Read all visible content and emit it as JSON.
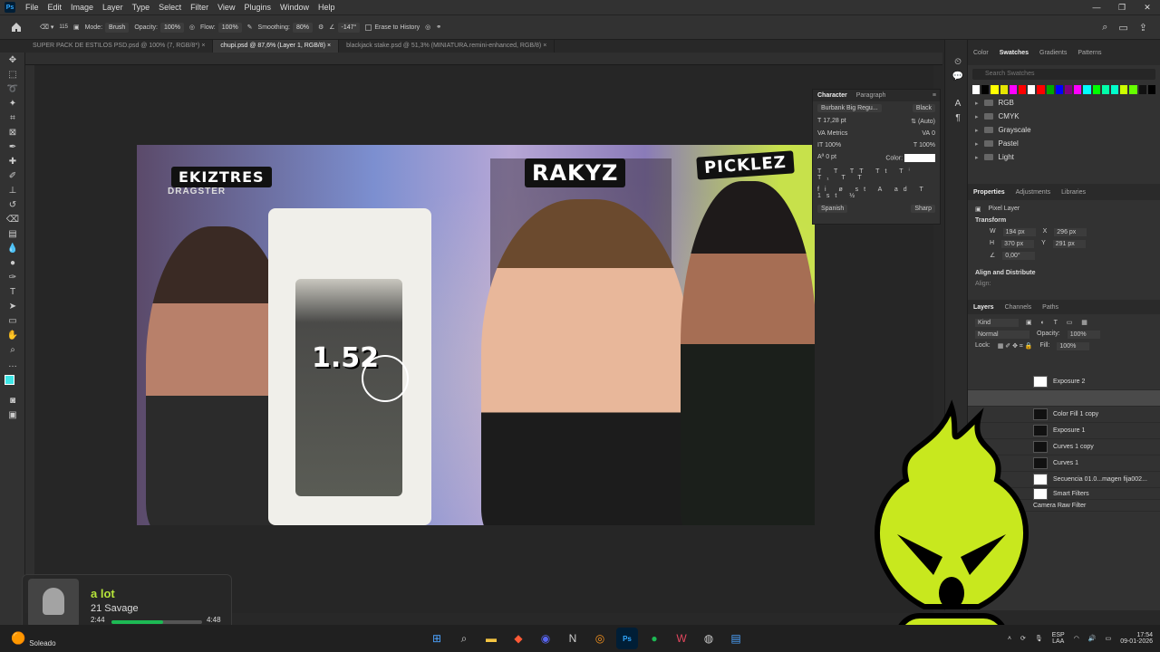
{
  "menubar": {
    "items": [
      "File",
      "Edit",
      "Image",
      "Layer",
      "Type",
      "Select",
      "Filter",
      "View",
      "Plugins",
      "Window",
      "Help"
    ],
    "app_icon": "Ps"
  },
  "options": {
    "mode_label": "Mode:",
    "mode_value": "Brush",
    "opacity_label": "Opacity:",
    "opacity_value": "100%",
    "flow_label": "Flow:",
    "flow_value": "100%",
    "smoothing_label": "Smoothing:",
    "smoothing_value": "80%",
    "angle_value": "-147°",
    "erase_history": "Erase to History",
    "brush_size": "115"
  },
  "tabs": [
    {
      "label": "SUPER PACK DE ESTILOS PSD.psd @ 100% (7, RGB/8*)"
    },
    {
      "label": "chupi.psd @ 87,6% (Layer 1, RGB/8)"
    },
    {
      "label": "blackjack stake.psd @ 51,3% (MINIATURA.remini-enhanced, RGB/8)"
    }
  ],
  "photo": {
    "names": [
      "EKIZTRES",
      "RAKYZ",
      "PICKLEZ"
    ],
    "number": "1.52",
    "dragster_text": "DRAGSTER"
  },
  "character": {
    "tab_character": "Character",
    "tab_paragraph": "Paragraph",
    "font": "Burbank Big Regu...",
    "style": "Black",
    "size": "17,28 pt",
    "leading": "(Auto)",
    "kerning": "Metrics",
    "tracking": "0",
    "vscale": "100%",
    "hscale": "100%",
    "baseline": "0 pt",
    "color_label": "Color:",
    "language": "Spanish",
    "antialias": "Sharp"
  },
  "swatches": {
    "tabs": [
      "Color",
      "Swatches",
      "Gradients",
      "Patterns"
    ],
    "search_placeholder": "Search Swatches",
    "colors": [
      "#ffffff",
      "#000000",
      "#ffff00",
      "#e6e600",
      "#ff00ff",
      "#ff0000",
      "#ffffff",
      "#ff0000",
      "#00aa00",
      "#0000ff",
      "#800080",
      "#ff00ff",
      "#00ffff",
      "#00ff00",
      "#00ffaa",
      "#00ffcc",
      "#ccff00",
      "#66ff00",
      "#111111",
      "#000000"
    ],
    "folders": [
      "RGB",
      "CMYK",
      "Grayscale",
      "Pastel",
      "Light"
    ]
  },
  "properties": {
    "tabs": [
      "Properties",
      "Adjustments",
      "Libraries"
    ],
    "kind": "Pixel Layer",
    "transform_label": "Transform",
    "w": "194 px",
    "h": "370 px",
    "x": "296 px",
    "y": "291 px",
    "angle": "0,00°",
    "align_label": "Align and Distribute",
    "align_sub": "Align:"
  },
  "layers": {
    "tabs": [
      "Layers",
      "Channels",
      "Paths"
    ],
    "filter_kind": "Kind",
    "blend": "Normal",
    "opacity_label": "Opacity:",
    "opacity": "100%",
    "lock_label": "Lock:",
    "fill_label": "Fill:",
    "fill": "100%",
    "items": [
      "Exposure 2",
      "",
      "Color Fill 1 copy",
      "Exposure 1",
      "Curves 1 copy",
      "Curves 1",
      "Secuencia 01.0...magen fija002...",
      "Smart Filters",
      "Camera Raw Filter"
    ]
  },
  "music": {
    "title": "a lot",
    "artist": "21 Savage",
    "elapsed": "2:44",
    "total": "4:48",
    "progress": 0.57
  },
  "taskbar": {
    "weather": "Soleado",
    "lang1": "ESP",
    "lang2": "LAA",
    "time": "17:54",
    "date": "09-01-2026"
  }
}
